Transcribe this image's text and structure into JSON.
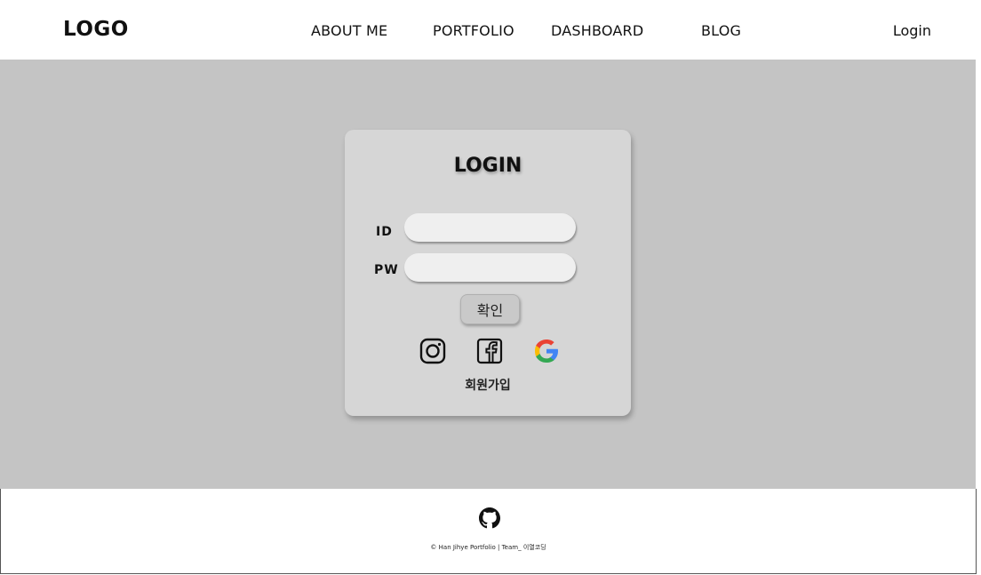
{
  "header": {
    "logo": "LOGO",
    "nav": [
      "ABOUT ME",
      "PORTFOLIO",
      "DASHBOARD",
      "BLOG"
    ],
    "login_link": "Login"
  },
  "login_card": {
    "title": "LOGIN",
    "id_label": "ID",
    "pw_label": "PW",
    "id_value": "",
    "pw_value": "",
    "confirm_label": "확인",
    "social_icons": [
      "instagram-icon",
      "facebook-icon",
      "google-icon"
    ],
    "signup_label": "회원가입"
  },
  "footer": {
    "icon": "github-icon",
    "copyright": "© Han Jihye Portfolio  |  Team_ 이열코딩"
  },
  "colors": {
    "main_bg": "#c4c4c4",
    "card_bg": "#d6d6d6",
    "input_bg": "#efefef"
  }
}
